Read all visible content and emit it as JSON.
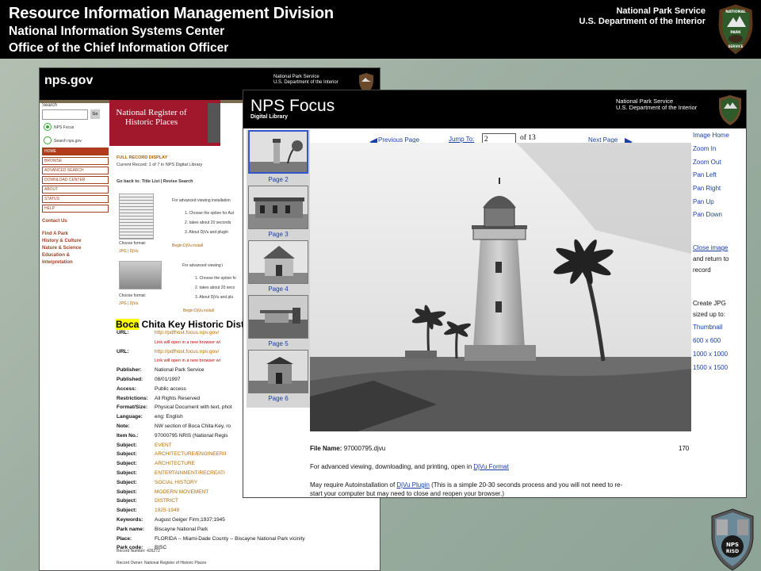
{
  "banner": {
    "line1": "Resource Information Management Division",
    "line2": "National Information Systems Center",
    "line3": "Office of the Chief Information Officer",
    "agency1": "National Park Service",
    "agency2": "U.S. Department of the Interior"
  },
  "back_page": {
    "logo": "nps.gov",
    "agency1": "National Park Service",
    "agency2": "U.S. Department of the Interior",
    "search_label": "Search",
    "go": "Go",
    "radio1": "NPS Focus",
    "radio2": "Search nps.gov",
    "nav": [
      "HOME",
      "BROWSE",
      "ADVANCED SEARCH",
      "DOWNLOAD CENTER",
      "ABOUT",
      "STATUS",
      "HELP"
    ],
    "contact": "Contact Us",
    "links": [
      "Find A Park",
      "History & Culture",
      "Nature & Science",
      "Education &",
      "Interpretation"
    ],
    "register": "National Register of Historic Places",
    "full_record": "FULL RECORD DISPLAY",
    "current_record": "Current Record: 1 of 7 in NPS Digital Library",
    "go_back": "Go back to: Title List | Revise Search",
    "adv1": "For advanced viewing installation",
    "adv1_steps": [
      "1.  Choose the option for Aut",
      "2.  takes about 20 seconds",
      "3.  About DjVu and plugin"
    ],
    "choose_format": "Choose format:",
    "formats": "JPG | DjVu",
    "begin_djvu": "Begin DjVu install",
    "adv2": "For advanced viewing i",
    "adv2_steps": [
      "1.  Choose the option fo",
      "2.  takes about 20 seco",
      "3.  About DjVu and plu"
    ],
    "title_hl": "Boca",
    "title_rest": " Chita Key Historic Distr",
    "records": [
      {
        "k": "URL:",
        "v": "http://pdfhost.focus.nps.gov/",
        "c": "or"
      },
      {
        "k": "",
        "v": "Link will open in a new browser wi",
        "c": "note"
      },
      {
        "k": "URL:",
        "v": "http://pdfhost.focus.nps.gov/",
        "c": "or"
      },
      {
        "k": "",
        "v": "Link will open in a new browser wi",
        "c": "note"
      },
      {
        "k": "Publisher:",
        "v": "National Park Service",
        "c": ""
      },
      {
        "k": "Published:",
        "v": "08/01/1997",
        "c": ""
      },
      {
        "k": "Access:",
        "v": "Public access",
        "c": ""
      },
      {
        "k": "Restrictions:",
        "v": "All Rights Reserved",
        "c": ""
      },
      {
        "k": "Format/Size:",
        "v": "Physical Document with text, phot",
        "c": ""
      },
      {
        "k": "Language:",
        "v": "eng: English",
        "c": ""
      },
      {
        "k": "Note:",
        "v": "NW section of Boca Chita Key, ro",
        "c": ""
      },
      {
        "k": "Item No.:",
        "v": "97000795 NRIS (National Regis",
        "c": ""
      },
      {
        "k": "Subject:",
        "v": "EVENT",
        "c": "sub"
      },
      {
        "k": "Subject:",
        "v": "ARCHITECTURE/ENGINEERII",
        "c": "sub"
      },
      {
        "k": "Subject:",
        "v": "ARCHITECTURE",
        "c": "sub"
      },
      {
        "k": "Subject:",
        "v": "ENTERTAINMENT/RECREATI",
        "c": "sub"
      },
      {
        "k": "Subject:",
        "v": "SOCIAL HISTORY",
        "c": "sub"
      },
      {
        "k": "Subject:",
        "v": "MODERN MOVEMENT",
        "c": "sub"
      },
      {
        "k": "Subject:",
        "v": "DISTRICT",
        "c": "sub"
      },
      {
        "k": "Subject:",
        "v": "1925-1949",
        "c": "sub"
      },
      {
        "k": "Keywords:",
        "v": "August Geiger Firm;1937;1945",
        "c": ""
      },
      {
        "k": "Park name:",
        "v": "Biscayne National Park",
        "c": ""
      },
      {
        "k": "Place:",
        "v": "FLORIDA -- Miami-Dade County -- Biscayne National Park vicinity",
        "c": ""
      },
      {
        "k": "Park code:",
        "v": "BISC",
        "c": ""
      }
    ],
    "record_number": "Record Number: 426272",
    "record_owner": "Record Owner: National Register of Historic Places"
  },
  "front_page": {
    "title": "NPS Focus",
    "subtitle": "Digital Library",
    "agency1": "National Park Service",
    "agency2": "U.S. Department of the Interior",
    "prev": "Previous Page",
    "jump": "Jump To:",
    "jump_value": "2",
    "of": "of 13",
    "next": "Next Page",
    "pages": [
      "Page 2",
      "Page 3",
      "Page 4",
      "Page 5",
      "Page 6"
    ],
    "right_links": [
      "Image Home",
      "Zoom In",
      "Zoom Out",
      "Pan Left",
      "Pan Right",
      "Pan Up",
      "Pan Down"
    ],
    "close_image": "Close image",
    "return1": "and return to",
    "return2": "record",
    "create1": "Create JPG",
    "create2": "sized up to:",
    "thumbnail": "Thumbnail",
    "sizes": [
      "600 x 600",
      "1000 x 1000",
      "1500 x 1500"
    ],
    "file_label": "File Name:",
    "file_name": "97000795.djvu",
    "page_num": "170",
    "adv_text": "For advanced viewing, downloading, and printing, open in ",
    "djvu_format": "DjVu Format",
    "may_req": "May require Autoinstallation of ",
    "djvu_plugin": "DjVu Plugin",
    "may_rest": " (This is a simple 20-30 seconds process and you will not need to re-",
    "restart": "start your computer but may need to close and reopen your browser.)"
  },
  "crest_text": "NPS RISD"
}
